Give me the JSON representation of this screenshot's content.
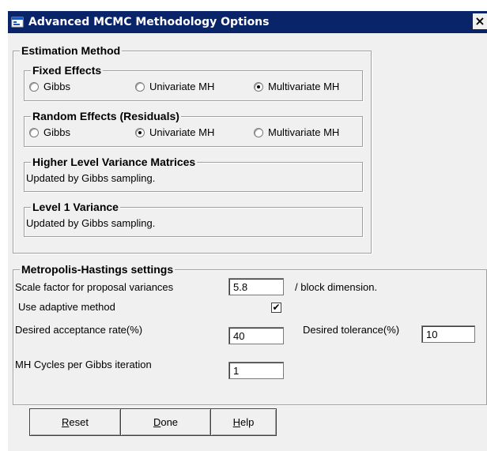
{
  "window": {
    "title": "Advanced MCMC Methodology Options",
    "close_glyph": "×"
  },
  "estimation": {
    "legend": "Estimation Method",
    "fixed": {
      "legend": "Fixed Effects",
      "options": [
        "Gibbs",
        "Univariate MH",
        "Multivariate MH"
      ],
      "selected": "Multivariate MH"
    },
    "random": {
      "legend": "Random Effects (Residuals)",
      "options": [
        "Gibbs",
        "Univariate MH",
        "Multivariate MH"
      ],
      "selected": "Univariate MH"
    },
    "higher": {
      "legend": "Higher Level  Variance Matrices",
      "text": "Updated by Gibbs sampling."
    },
    "level1": {
      "legend": "Level 1 Variance",
      "text": "Updated by Gibbs sampling."
    }
  },
  "mh": {
    "legend": "Metropolis-Hastings settings",
    "scale_label": "Scale factor for proposal variances",
    "scale_value": "5.8",
    "scale_suffix": "/ block dimension.",
    "adaptive_label": "Use adaptive method",
    "adaptive_checked": true,
    "acceptance_label": "Desired acceptance rate(%)",
    "acceptance_value": "40",
    "tolerance_label": "Desired tolerance(%)",
    "tolerance_value": "10",
    "cycles_label": "MH Cycles per Gibbs iteration",
    "cycles_value": "1"
  },
  "buttons": {
    "reset": {
      "mnemonic": "R",
      "rest": "eset"
    },
    "done": {
      "mnemonic": "D",
      "rest": "one"
    },
    "help": {
      "mnemonic": "H",
      "rest": "elp"
    }
  },
  "colors": {
    "titlebar": "#0a246a",
    "face": "#f0f0f0"
  },
  "icons": {
    "app": "app-icon",
    "check": "✔"
  }
}
